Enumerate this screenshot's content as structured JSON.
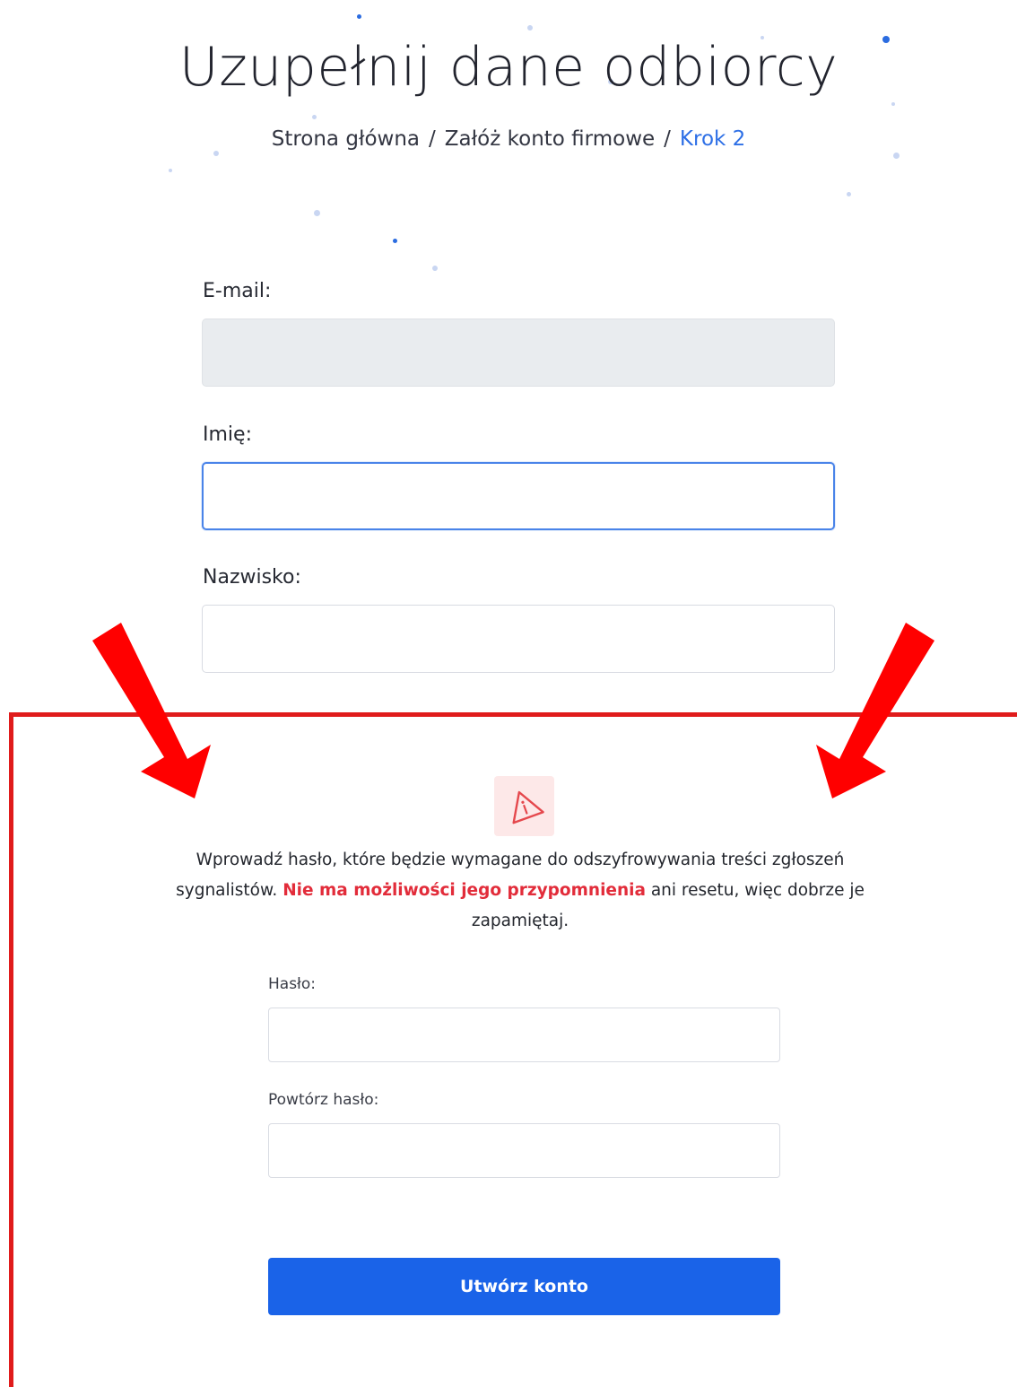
{
  "header": {
    "title": "Uzupełnij dane odbiorcy",
    "breadcrumb": {
      "home": "Strona główna",
      "separator": "/",
      "middle": "Załóż konto firmowe",
      "current": "Krok 2"
    }
  },
  "form": {
    "email_label": "E-mail:",
    "email_value": "",
    "first_name_label": "Imię:",
    "first_name_value": "",
    "last_name_label": "Nazwisko:",
    "last_name_value": ""
  },
  "password_section": {
    "icon": "warning-triangle-icon",
    "info_before": "Wprowadź hasło, które będzie wymagane do odszyfrowywania treści zgłoszeń sygnalistów. ",
    "info_highlight": "Nie ma możliwości jego przypomnienia",
    "info_after": " ani resetu, więc dobrze je zapamiętaj.",
    "password_label": "Hasło:",
    "password_value": "",
    "repeat_label": "Powtórz hasło:",
    "repeat_value": "",
    "submit_label": "Utwórz konto"
  },
  "colors": {
    "accent": "#1a63e8",
    "breadcrumb_current": "#2d6fe6",
    "warning_text": "#e22c3a",
    "annotation_red": "#e01b1b",
    "warning_bg": "#fde8e8"
  }
}
